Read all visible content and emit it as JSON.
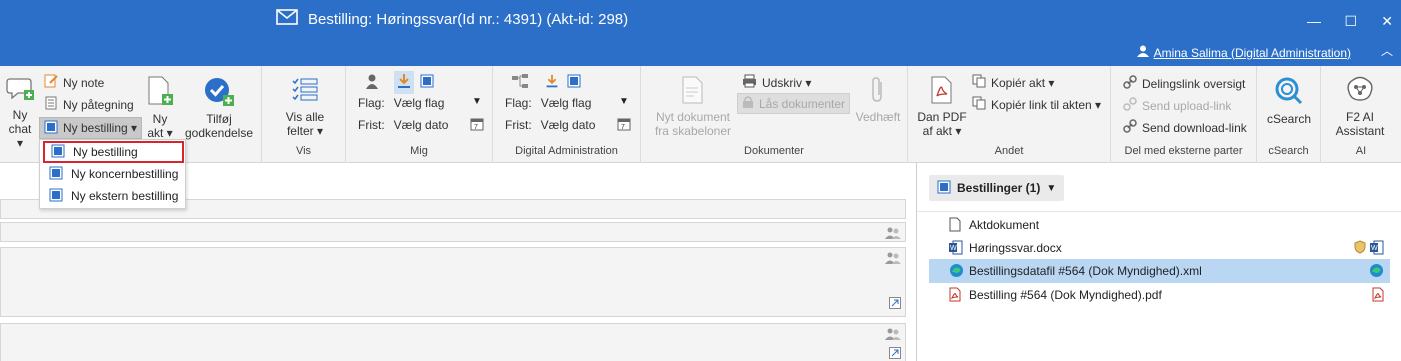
{
  "window": {
    "title": "Bestilling: Høringssvar(Id nr.: 4391) (Akt-id: 298)",
    "user": "Amina Salima (Digital Administration)"
  },
  "ribbon": {
    "chat": {
      "label1": "Ny",
      "label2": "chat ▾"
    },
    "ny_note": "Ny note",
    "ny_paategning": "Ny påtegning",
    "ny_bestilling": "Ny bestilling ▾",
    "ny_akt": {
      "label1": "Ny",
      "label2": "akt ▾"
    },
    "tilfoej": {
      "label1": "Tilføj",
      "label2": "godkendelse"
    },
    "vis": {
      "btn1": "Vis alle",
      "btn2": "felter ▾",
      "group": "Vis"
    },
    "mig": {
      "flag_label": "Flag:",
      "flag_value": "Vælg flag",
      "frist_label": "Frist:",
      "frist_value": "Vælg dato",
      "group": "Mig"
    },
    "da": {
      "flag_label": "Flag:",
      "flag_value": "Vælg flag",
      "frist_label": "Frist:",
      "frist_value": "Vælg dato",
      "group": "Digital Administration"
    },
    "dokumenter": {
      "nyt_dok1": "Nyt dokument",
      "nyt_dok2": "fra skabeloner",
      "udskriv": "Udskriv ▾",
      "laas": "Lås dokumenter",
      "vedhaeft": "Vedhæft",
      "group": "Dokumenter"
    },
    "andet": {
      "danpdf1": "Dan PDF",
      "danpdf2": "af akt ▾",
      "kopier_akt": "Kopiér akt ▾",
      "kopier_link": "Kopiér link til akten ▾",
      "group": "Andet"
    },
    "del": {
      "delingslink": "Delingslink oversigt",
      "upload": "Send upload-link",
      "download": "Send download-link",
      "group": "Del med eksterne parter"
    },
    "csearch": {
      "label": "cSearch",
      "group": "cSearch"
    },
    "ai": {
      "label1": "F2 AI",
      "label2": "Assistant",
      "group": "AI"
    }
  },
  "menu": {
    "items": [
      "Ny bestilling",
      "Ny koncernbestilling",
      "Ny ekstern bestilling"
    ]
  },
  "right_panel": {
    "header": "Bestillinger (1)",
    "files": [
      "Aktdokument",
      "Høringssvar.docx",
      "Bestillingsdatafil #564 (Dok Myndighed).xml",
      "Bestilling #564 (Dok Myndighed).pdf"
    ]
  },
  "colors": {
    "titlebar": "#2b6fc9",
    "highlight": "#d9232e",
    "selected_row": "#b9d7f2"
  }
}
